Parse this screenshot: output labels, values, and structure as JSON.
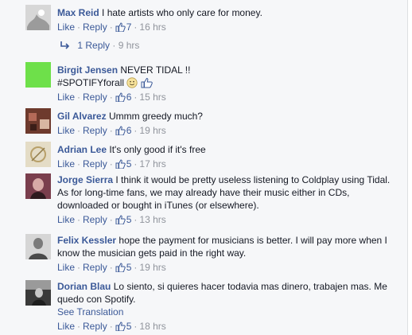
{
  "comments": [
    {
      "author": "Max Reid",
      "text": "I hate artists who only care for money.",
      "like": "Like",
      "reply": "Reply",
      "count": "7",
      "time": "16 hrs",
      "avatar_colors": [
        "#d7d7d7",
        "#9b9b9b"
      ]
    },
    {
      "author": "Birgit Jensen",
      "text": "NEVER TIDAL !!",
      "hashtag": "#SPOTIFYforall",
      "like": "Like",
      "reply": "Reply",
      "count": "6",
      "time": "15 hrs",
      "avatar_colors": [
        "#6ee04a"
      ]
    },
    {
      "author": "Gil Alvarez",
      "text": "Ummm greedy much?",
      "like": "Like",
      "reply": "Reply",
      "count": "6",
      "time": "19 hrs",
      "avatar_colors": [
        "#6e3a2d",
        "#b46a58"
      ]
    },
    {
      "author": "Adrian Lee",
      "text": "It's only good if it's free",
      "like": "Like",
      "reply": "Reply",
      "count": "5",
      "time": "17 hrs",
      "avatar_colors": [
        "#e4dcc6",
        "#b8a06a"
      ]
    },
    {
      "author": "Jorge Sierra",
      "text": "I think it would be pretty useless listening to Coldplay using Tidal. As for long-time fans, we may already have their music either in CDs, downloaded or bought in iTunes (or elsewhere).",
      "like": "Like",
      "reply": "Reply",
      "count": "5",
      "time": "13 hrs",
      "avatar_colors": [
        "#7a3e4d",
        "#d7a9a6"
      ]
    },
    {
      "author": "Felix Kessler",
      "text": "hope the payment for musicians is better. I will pay more when I know the musician gets paid in the right way.",
      "like": "Like",
      "reply": "Reply",
      "count": "5",
      "time": "19 hrs",
      "avatar_colors": [
        "#d6d6d6",
        "#7b7b7b"
      ]
    },
    {
      "author": "Dorian Blau",
      "text": "Lo siento, si quieres hacer todavia mas dinero, trabajen mas. Me quedo con Spotify.",
      "see_translation": "See Translation",
      "like": "Like",
      "reply": "Reply",
      "count": "5",
      "time": "18 hrs",
      "avatar_colors": [
        "#3a3a3a",
        "#9a9a9a"
      ]
    }
  ],
  "reply_summary": {
    "label": "1 Reply",
    "time": "9 hrs"
  },
  "colors": {
    "link": "#3b5998",
    "meta": "#90949c",
    "panel": "#f6f7f9"
  }
}
